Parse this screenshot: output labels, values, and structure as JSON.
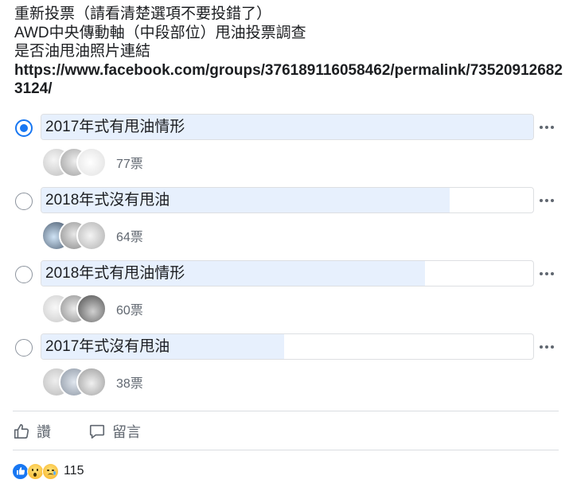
{
  "post": {
    "lines": [
      "重新投票（請看清楚選項不要投錯了）",
      "AWD中央傳動軸（中段部位）甩油投票調查",
      "是否油甩油照片連結"
    ],
    "link": "https://www.facebook.com/groups/376189116058462/permalink/735209126823124/"
  },
  "poll": {
    "options": [
      {
        "label": "2017年式有甩油情形",
        "votes_text": "77票",
        "fill_fraction": 1.0,
        "selected": true
      },
      {
        "label": "2018年式沒有甩油",
        "votes_text": "64票",
        "fill_fraction": 0.83,
        "selected": false
      },
      {
        "label": "2018年式有甩油情形",
        "votes_text": "60票",
        "fill_fraction": 0.78,
        "selected": false
      },
      {
        "label": "2017年式沒有甩油",
        "votes_text": "38票",
        "fill_fraction": 0.494,
        "selected": false
      }
    ]
  },
  "actions": {
    "like_label": "讚",
    "comment_label": "留言"
  },
  "reactions": {
    "icons": [
      "like-icon",
      "wow-icon",
      "sad-icon"
    ],
    "count": "115"
  },
  "colors": {
    "accent": "#1877f2",
    "bar_fill": "#e7f0fd",
    "muted": "#606770"
  }
}
